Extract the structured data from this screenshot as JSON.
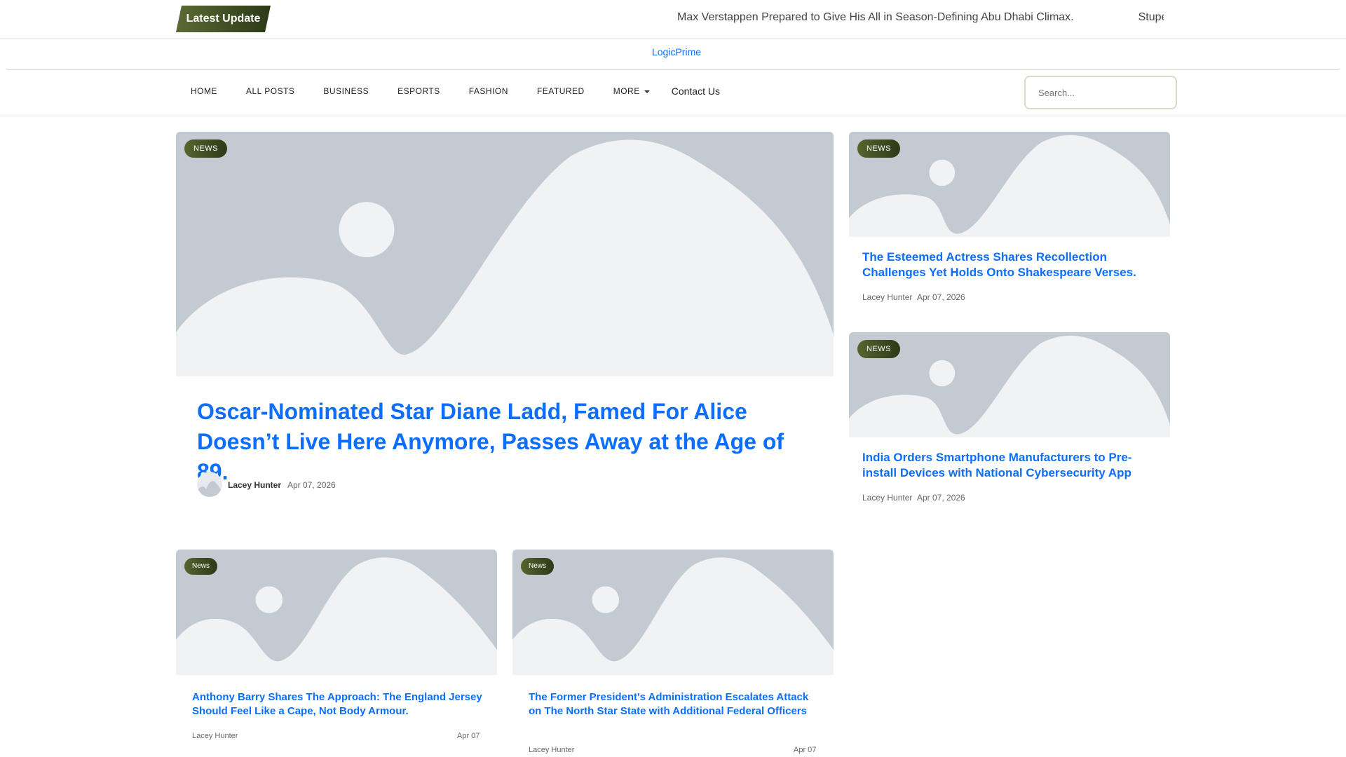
{
  "topbar": {
    "latest_label": "Latest Update",
    "ticker": [
      "Max Verstappen Prepared to Give His All in Season-Defining Abu Dhabi Climax.",
      "Stupendous"
    ]
  },
  "brand": "LogicPrime",
  "nav": {
    "items": [
      "HOME",
      "ALL POSTS",
      "BUSINESS",
      "ESPORTS",
      "FASHION",
      "FEATURED",
      "MORE"
    ],
    "contact": "Contact Us"
  },
  "search": {
    "placeholder": "Search..."
  },
  "hero": {
    "tag": "NEWS",
    "title": "Oscar-Nominated Star Diane Ladd, Famed For Alice Doesn’t Live Here Anymore, Passes Away at the Age of 89.",
    "author": "Lacey Hunter",
    "date": "Apr 07, 2026"
  },
  "side": [
    {
      "tag": "NEWS",
      "title": "The Esteemed Actress Shares Recollection Challenges Yet Holds Onto Shakespeare Verses.",
      "author": "Lacey Hunter",
      "date": "Apr 07, 2026"
    },
    {
      "tag": "NEWS",
      "title": "India Orders Smartphone Manufacturers to Pre-install Devices with National Cybersecurity App",
      "author": "Lacey Hunter",
      "date": "Apr 07, 2026"
    }
  ],
  "grid": [
    {
      "tag": "News",
      "title": "Anthony Barry Shares The Approach: The England Jersey Should Feel Like a Cape, Not Body Armour.",
      "author": "Lacey Hunter",
      "date": "Apr 07"
    },
    {
      "tag": "News",
      "title": "The Former President's Administration Escalates Attack on The North Star State with Additional Federal Officers",
      "author": "Lacey Hunter",
      "date": "Apr 07"
    }
  ],
  "colors": {
    "accent": "#0d6efd",
    "tag": "#3d4c22",
    "placeholder": "#c3cad2"
  }
}
